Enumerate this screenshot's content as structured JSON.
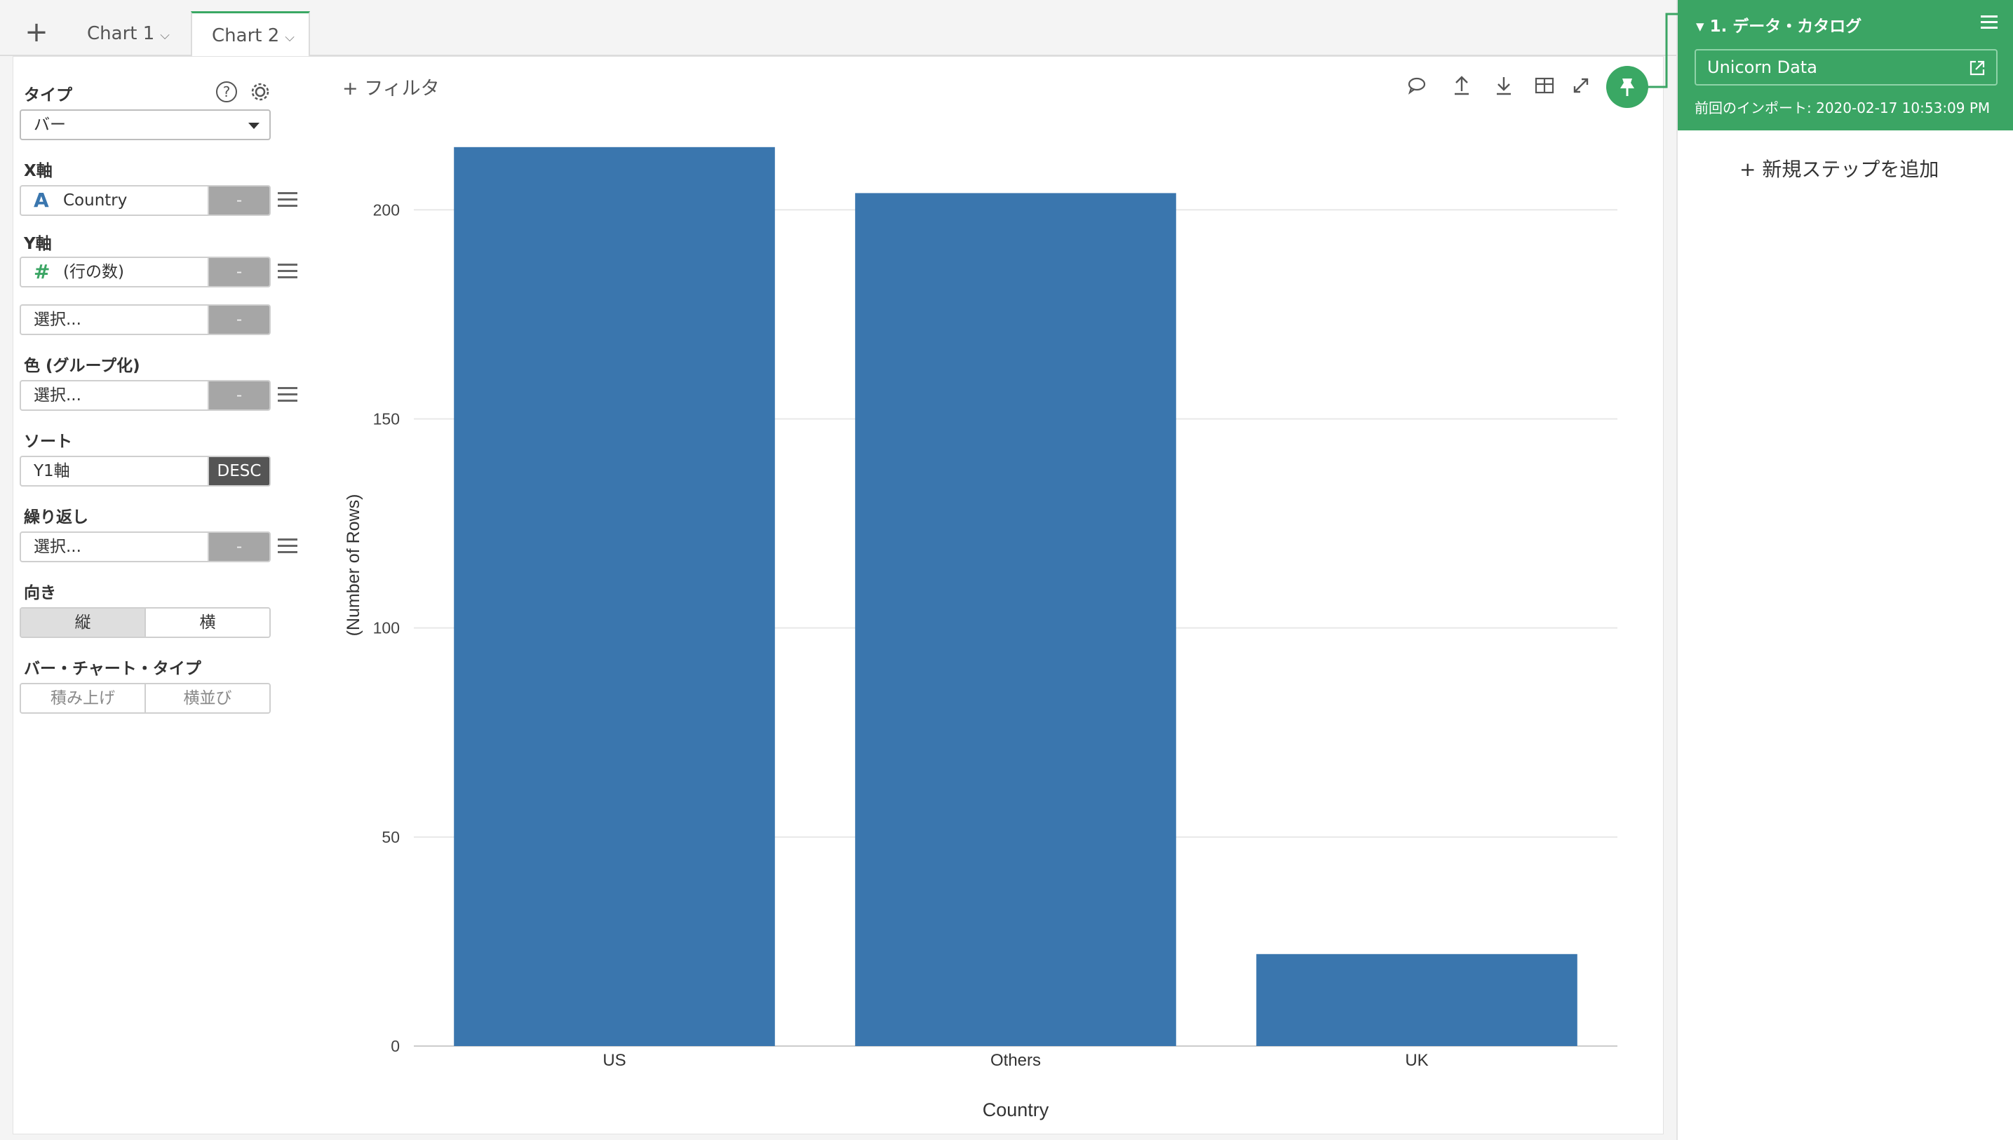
{
  "tabs": {
    "add_label": "+",
    "items": [
      {
        "label": "Chart 1",
        "chevron": "⌵"
      },
      {
        "label": "Chart 2",
        "chevron": "⌵"
      }
    ]
  },
  "sidebar": {
    "type_label": "タイプ",
    "type_value": "バー",
    "x_label": "X軸",
    "x_icon": "A",
    "x_value": "Country",
    "x_btn": "-",
    "y_label": "Y軸",
    "y_icon": "#",
    "y_value": "(行の数)",
    "y_btn": "-",
    "y2_value": "選択...",
    "y2_btn": "-",
    "color_label": "色 (グループ化)",
    "color_value": "選択...",
    "color_btn": "-",
    "sort_label": "ソート",
    "sort_value": "Y1軸",
    "sort_btn": "DESC",
    "repeat_label": "繰り返し",
    "repeat_value": "選択...",
    "repeat_btn": "-",
    "orient_label": "向き",
    "orient_options": [
      "縦",
      "横"
    ],
    "bartype_label": "バー・チャート・タイプ",
    "bartype_options": [
      "積み上げ",
      "横並び"
    ]
  },
  "toolbar": {
    "filter_label": "+ フィルタ"
  },
  "colors": {
    "bar": "#3a76ae",
    "accent": "#3ba564"
  },
  "chart_data": {
    "type": "bar",
    "categories": [
      "US",
      "Others",
      "UK"
    ],
    "values": [
      215,
      204,
      22
    ],
    "xlabel": "Country",
    "ylabel": "(Number of Rows)",
    "ylim": [
      0,
      220
    ],
    "yticks": [
      0,
      50,
      100,
      150,
      200
    ],
    "grid": true
  },
  "step": {
    "title": "1. データ・カタログ",
    "source": "Unicorn Data",
    "import_time": "前回のインポート: 2020-02-17 10:53:09 PM",
    "add_step": "+ 新規ステップを追加"
  }
}
